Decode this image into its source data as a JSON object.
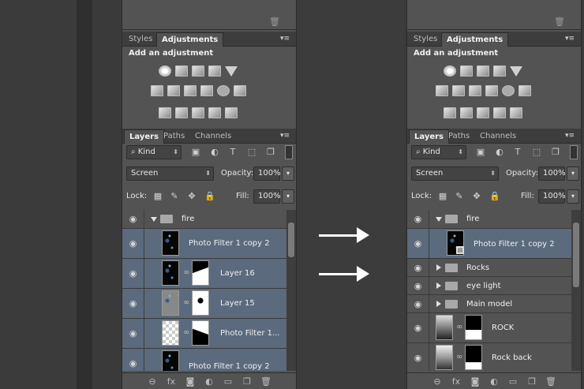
{
  "panels": [
    {
      "tabs_top": [
        "Styles",
        "Adjustments"
      ],
      "adjustment_title": "Add an adjustment",
      "layer_tabs": [
        "Layers",
        "Paths",
        "Channels"
      ],
      "kind_label": "Kind",
      "blend_mode": "Screen",
      "opacity_label": "Opacity:",
      "opacity_value": "100%",
      "lock_label": "Lock:",
      "fill_label": "Fill:",
      "fill_value": "100%",
      "layers": [
        "fire",
        "Photo Filter 1 copy 2",
        "Layer 16",
        "Layer 15",
        "Photo Filter 1...",
        "Photo Filter 1 copy 2"
      ]
    },
    {
      "tabs_top": [
        "Styles",
        "Adjustments"
      ],
      "adjustment_title": "Add an adjustment",
      "layer_tabs": [
        "Layers",
        "Paths",
        "Channels"
      ],
      "kind_label": "Kind",
      "blend_mode": "Screen",
      "opacity_label": "Opacity:",
      "opacity_value": "100%",
      "lock_label": "Lock:",
      "fill_label": "Fill:",
      "fill_value": "100%",
      "layers": [
        "fire",
        "Photo Filter 1 copy 2",
        "Rocks",
        "eye light",
        "Main model",
        "ROCK",
        "Rock back"
      ]
    }
  ],
  "icons": {
    "eye": "eye-icon",
    "folder": "folder-icon",
    "link": "link-icon",
    "trash": "trash-icon",
    "fx": "fx-icon"
  },
  "bottom_bar": {
    "fx_label": "fx"
  },
  "colors": {
    "selected_row": "#5b6a7d",
    "panel_bg": "#535353",
    "arrow": "#ffffff"
  }
}
